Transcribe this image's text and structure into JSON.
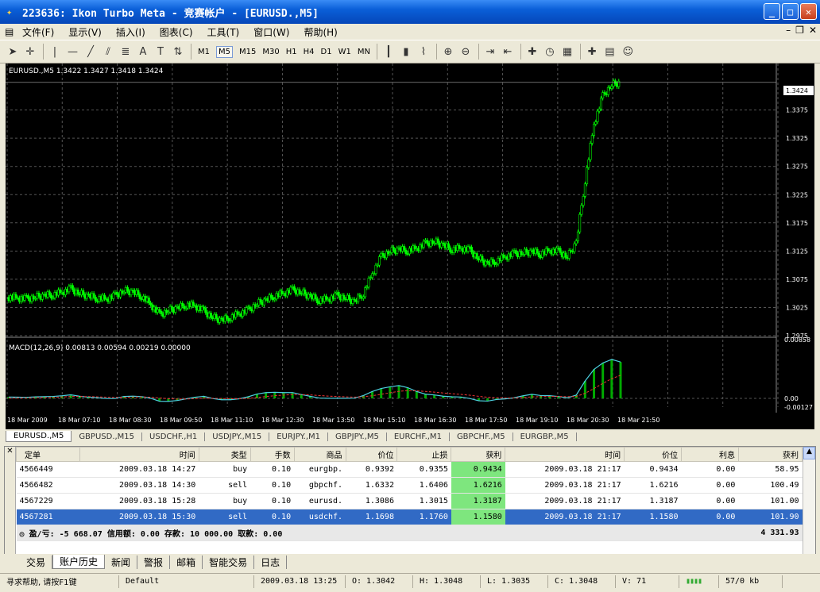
{
  "window": {
    "title": "223636: Ikon Turbo Meta - 竞赛帐户 - [EURUSD.,M5]"
  },
  "menu": [
    "文件(F)",
    "显示(V)",
    "插入(I)",
    "图表(C)",
    "工具(T)",
    "窗口(W)",
    "帮助(H)"
  ],
  "toolbar": {
    "timeframes": [
      "M1",
      "M5",
      "M15",
      "M30",
      "H1",
      "H4",
      "D1",
      "W1",
      "MN"
    ],
    "active_timeframe": "M5"
  },
  "chart_data": [
    {
      "type": "candlestick",
      "title": "EURUSD.,M5  1.3422 1.3427 1.3418 1.3424",
      "current_price": "1.3424",
      "ylim": [
        1.2975,
        1.3449
      ],
      "y_ticks": [
        "1.3375",
        "1.3325",
        "1.3275",
        "1.3225",
        "1.3175",
        "1.3125",
        "1.3075",
        "1.3025",
        "1.2975"
      ],
      "x_ticks": [
        "18 Mar 2009",
        "18 Mar 07:10",
        "18 Mar 08:30",
        "18 Mar 09:50",
        "18 Mar 11:10",
        "18 Mar 12:30",
        "18 Mar 13:50",
        "18 Mar 15:10",
        "18 Mar 16:30",
        "18 Mar 17:50",
        "18 Mar 19:10",
        "18 Mar 20:30",
        "18 Mar 21:50"
      ],
      "series": [
        {
          "values": [
            1.3043,
            1.3042,
            1.304,
            1.3044,
            1.3046,
            1.3048,
            1.3052,
            1.3058,
            1.305,
            1.3045,
            1.3042,
            1.304,
            1.3046,
            1.3055,
            1.3052,
            1.3045,
            1.303,
            1.3012,
            1.302,
            1.3024,
            1.303,
            1.3028,
            1.3018,
            1.3008,
            1.3002,
            1.3008,
            1.3014,
            1.302,
            1.3032,
            1.3038,
            1.3046,
            1.305,
            1.3056,
            1.3052,
            1.3044,
            1.3038,
            1.304,
            1.3046,
            1.3042,
            1.3035,
            1.305,
            1.3085,
            1.3115,
            1.3125,
            1.3128,
            1.3126,
            1.313,
            1.3138,
            1.3142,
            1.3135,
            1.3128,
            1.313,
            1.3126,
            1.3112,
            1.3102,
            1.3108,
            1.3115,
            1.312,
            1.3122,
            1.3124,
            1.312,
            1.3126,
            1.3124,
            1.3115,
            1.314,
            1.325,
            1.335,
            1.34,
            1.342,
            1.3424
          ]
        }
      ]
    },
    {
      "type": "macd",
      "title": "MACD(12,26,9) 0.00813 0.00594 0.00219 0.00000",
      "ylim": [
        -0.00127,
        0.00858
      ],
      "y_ticks": [
        "0.00858",
        "0.00",
        "-0.00127"
      ]
    }
  ],
  "chart_tabs": [
    "EURUSD.,M5",
    "GBPUSD.,M15",
    "USDCHF.,H1",
    "USDJPY.,M15",
    "EURJPY.,M1",
    "GBPJPY.,M5",
    "EURCHF.,M1",
    "GBPCHF.,M5",
    "EURGBP.,M5"
  ],
  "orders": {
    "columns": [
      "定单",
      "时间",
      "类型",
      "手数",
      "商品",
      "价位",
      "止损",
      "获利",
      "时间",
      "价位",
      "利息",
      "获利"
    ],
    "rows": [
      [
        "4566449",
        "2009.03.18 14:27",
        "buy",
        "0.10",
        "eurgbp.",
        "0.9392",
        "0.9355",
        "0.9434",
        "2009.03.18 21:17",
        "0.9434",
        "0.00",
        "58.95"
      ],
      [
        "4566482",
        "2009.03.18 14:30",
        "sell",
        "0.10",
        "gbpchf.",
        "1.6332",
        "1.6406",
        "1.6216",
        "2009.03.18 21:17",
        "1.6216",
        "0.00",
        "100.49"
      ],
      [
        "4567229",
        "2009.03.18 15:28",
        "buy",
        "0.10",
        "eurusd.",
        "1.3086",
        "1.3015",
        "1.3187",
        "2009.03.18 21:17",
        "1.3187",
        "0.00",
        "101.00"
      ],
      [
        "4567281",
        "2009.03.18 15:30",
        "sell",
        "0.10",
        "usdchf.",
        "1.1698",
        "1.1760",
        "1.1580",
        "2009.03.18 21:17",
        "1.1580",
        "0.00",
        "101.90"
      ]
    ],
    "summary": "盈/亏: -5 668.07  信用额: 0.00  存款: 10 000.00  取款: 0.00",
    "total": "4 331.93"
  },
  "bottom_tabs": [
    "交易",
    "账户历史",
    "新闻",
    "警报",
    "邮箱",
    "智能交易",
    "日志"
  ],
  "status": {
    "help": "寻求帮助, 请按F1键",
    "profile": "Default",
    "time": "2009.03.18 13:25",
    "o": "O: 1.3042",
    "h": "H: 1.3048",
    "l": "L: 1.3035",
    "c": "C: 1.3048",
    "v": "V: 71",
    "traffic": "57/0 kb"
  }
}
